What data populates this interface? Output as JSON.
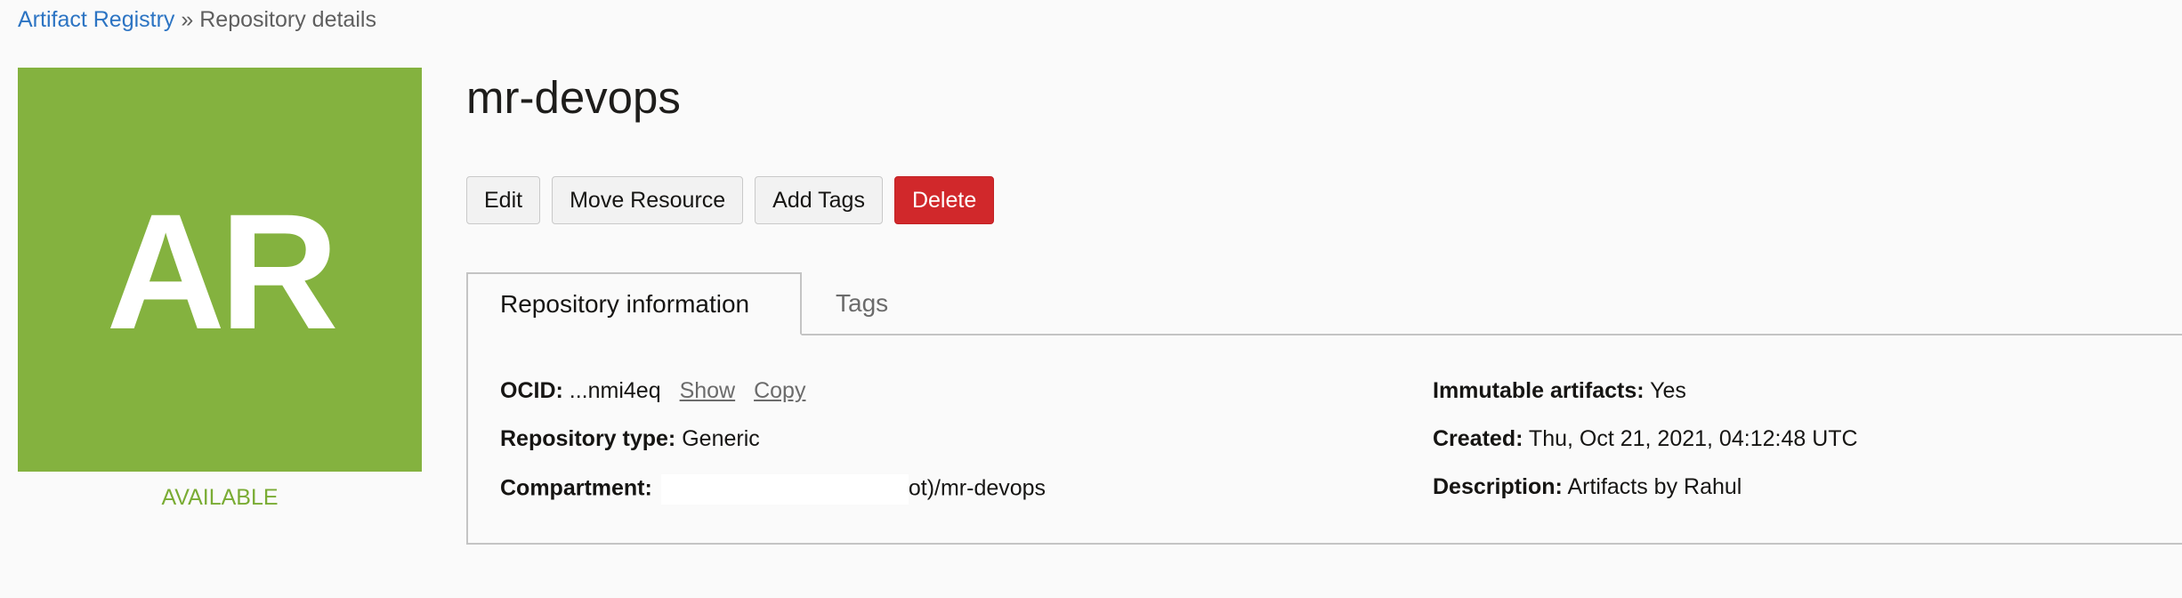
{
  "breadcrumb": {
    "parent": "Artifact Registry",
    "separator": " » ",
    "current": "Repository details"
  },
  "badge": {
    "initials": "AR",
    "color": "#84b23f",
    "state": "AVAILABLE"
  },
  "title": "mr-devops",
  "actions": {
    "edit": "Edit",
    "move": "Move Resource",
    "add_tags": "Add Tags",
    "delete": "Delete"
  },
  "tabs": [
    {
      "label": "Repository information",
      "active": true
    },
    {
      "label": "Tags",
      "active": false
    }
  ],
  "info": {
    "ocid": {
      "label": "OCID:",
      "value": "...nmi4eq",
      "show": "Show",
      "copy": "Copy"
    },
    "repo_type": {
      "label": "Repository type:",
      "value": "Generic"
    },
    "compartment": {
      "label": "Compartment:",
      "value": "ot)/mr-devops"
    },
    "immutable": {
      "label": "Immutable artifacts:",
      "value": "Yes"
    },
    "created": {
      "label": "Created:",
      "value": "Thu, Oct 21, 2021, 04:12:48 UTC"
    },
    "description": {
      "label": "Description:",
      "value": "Artifacts by Rahul"
    }
  },
  "colors": {
    "accent_link": "#2c74c3",
    "danger": "#d1282b",
    "status_available": "#7aac34"
  }
}
